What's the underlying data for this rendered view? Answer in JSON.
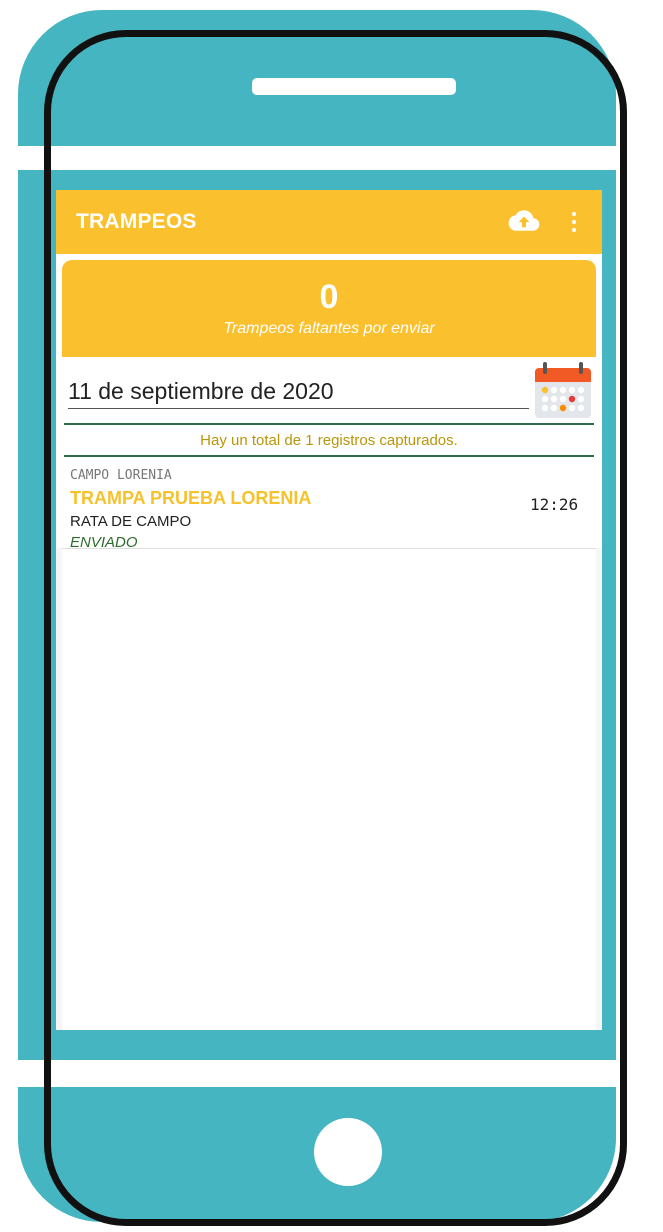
{
  "appbar": {
    "title": "TRAMPEOS",
    "upload_icon": "cloud-upload-icon",
    "menu_icon": "more-vert-icon"
  },
  "summary": {
    "count": "0",
    "label": "Trampeos faltantes por enviar"
  },
  "date": {
    "value": "11 de septiembre de 2020",
    "calendar_icon": "calendar-icon"
  },
  "total_text": "Hay un total de 1 registros capturados.",
  "records": [
    {
      "campo": "CAMPO LORENIA",
      "trampa": "TRAMPA PRUEBA LORENIA",
      "especie": "RATA DE CAMPO",
      "estado": "ENVIADO",
      "hora": "12:26"
    }
  ],
  "colors": {
    "frame_teal": "#45b6c1",
    "appbar_yellow": "#fbc02d",
    "divider_green": "#2e6b4a",
    "total_text": "#b8960b"
  }
}
